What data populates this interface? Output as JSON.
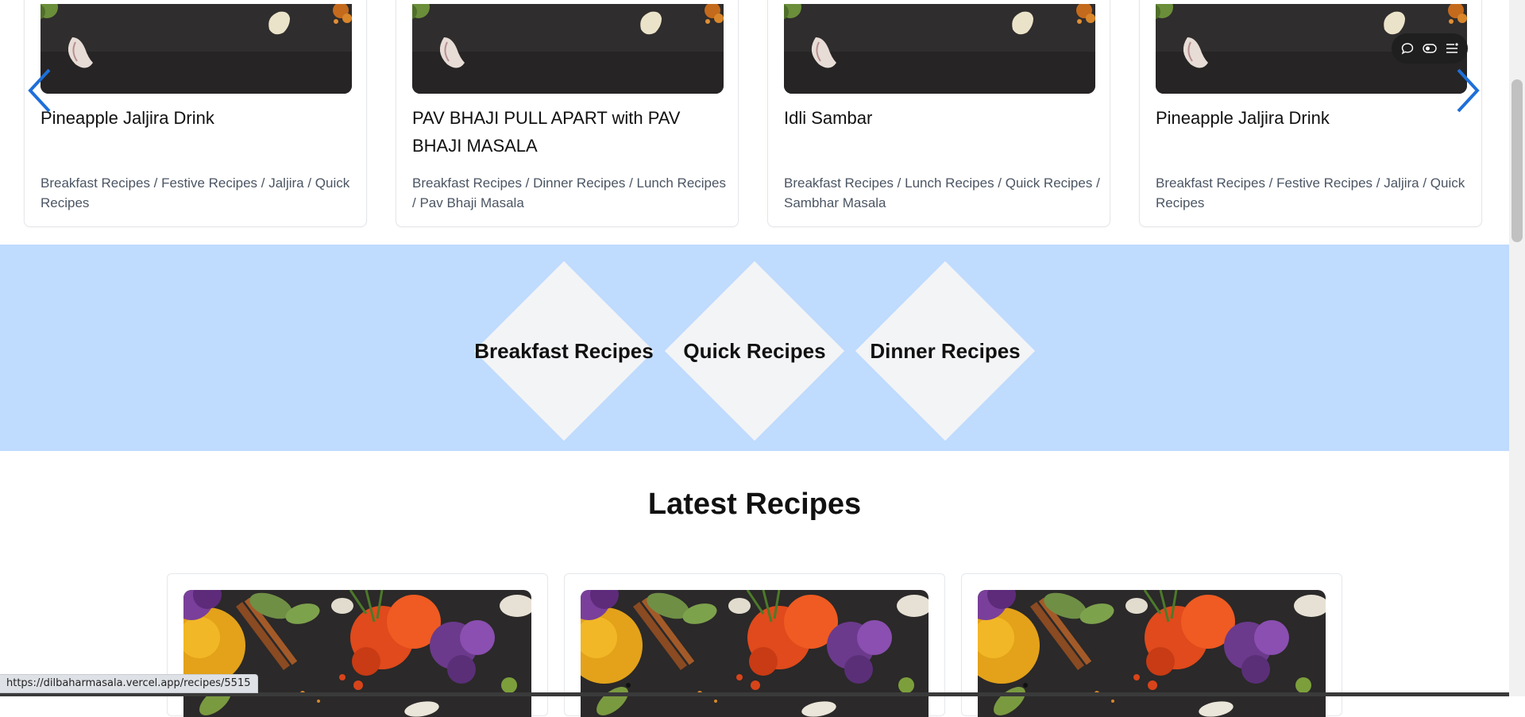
{
  "carousel": {
    "cards": [
      {
        "title": "Pineapple Jaljira Drink",
        "categories": "Breakfast Recipes / Festive Recipes / Jaljira / Quick Recipes"
      },
      {
        "title": "PAV BHAJI PULL APART with PAV BHAJI MASALA",
        "categories": "Breakfast Recipes / Dinner Recipes / Lunch Recipes / Pav Bhaji Masala"
      },
      {
        "title": "Idli Sambar",
        "categories": "Breakfast Recipes / Lunch Recipes / Quick Recipes / Sambhar Masala"
      },
      {
        "title": "Pineapple Jaljira Drink",
        "categories": "Breakfast Recipes / Festive Recipes / Jaljira / Quick Recipes"
      }
    ],
    "prev_icon": "chevron-left-icon",
    "next_icon": "chevron-right-icon"
  },
  "toolbar": {
    "icons": [
      "chat-bubble-icon",
      "toggle-icon",
      "menu-list-icon"
    ]
  },
  "categories": {
    "items": [
      {
        "label": "Breakfast Recipes"
      },
      {
        "label": "Quick Recipes"
      },
      {
        "label": "Dinner Recipes"
      }
    ]
  },
  "latest": {
    "title": "Latest Recipes"
  },
  "status": {
    "url": "https://dilbaharmasala.vercel.app/recipes/5515"
  },
  "colors": {
    "band_bg": "#bfdbfe",
    "diamond_bg": "#f3f4f6",
    "arrow": "#1e6fd9"
  }
}
